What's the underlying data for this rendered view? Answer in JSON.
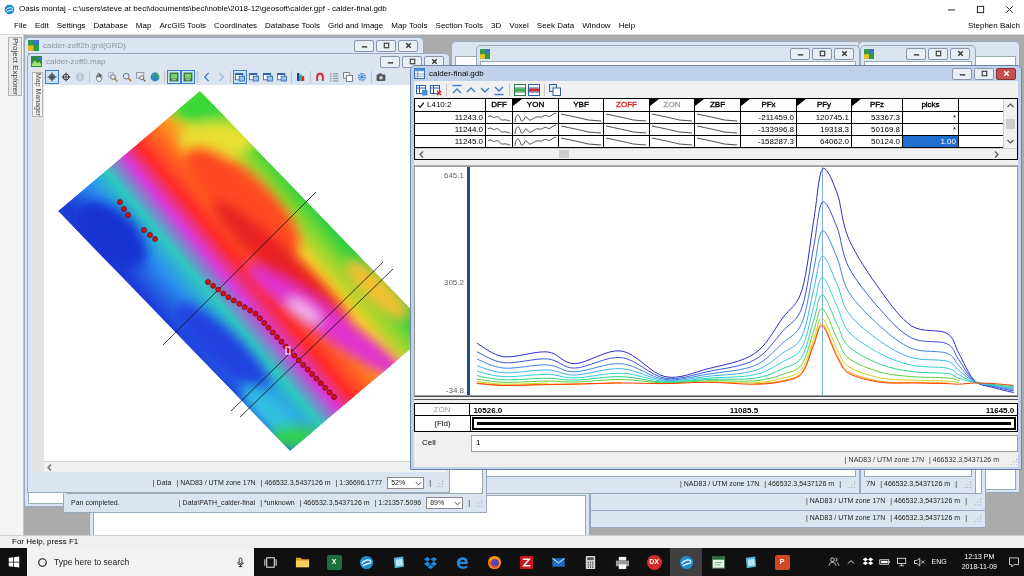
{
  "title_bar": {
    "title": "Oasis montaj - c:\\users\\steve at beci\\documents\\beci\\noble\\2018-12\\geosoft\\calder.gpf - calder-final.gdb"
  },
  "menu": {
    "items": [
      "File",
      "Edit",
      "Settings",
      "Database",
      "Map",
      "ArcGIS Tools",
      "Coordinates",
      "Database Tools",
      "Grid and Image",
      "Map Tools",
      "Section Tools",
      "3D",
      "Voxel",
      "Seek Data",
      "Window",
      "Help"
    ],
    "user": "Stephen Balch"
  },
  "project_explorer": {
    "label": "Project Explorer"
  },
  "grid_window": {
    "title": "calder-zoff2b.grd(GRD)"
  },
  "map_window": {
    "title": "calder-zoff0.map",
    "side_tab": "Map Manager",
    "toolbar": [
      [
        {
          "kind": "crosshair",
          "selected": true,
          "disabled": false
        },
        {
          "kind": "target",
          "selected": false,
          "disabled": false
        },
        {
          "kind": "info",
          "selected": false,
          "disabled": true
        }
      ],
      [
        {
          "kind": "hand",
          "selected": false,
          "disabled": false
        },
        {
          "kind": "magnifier-box",
          "selected": false,
          "disabled": false
        },
        {
          "kind": "magnifier",
          "selected": false,
          "disabled": false
        },
        {
          "kind": "box-magnifier",
          "selected": false,
          "disabled": false
        },
        {
          "kind": "globe",
          "selected": false,
          "disabled": false
        }
      ],
      [
        {
          "kind": "map-tile",
          "selected": true,
          "disabled": false
        },
        {
          "kind": "map-tile",
          "selected": true,
          "disabled": false
        }
      ],
      [
        {
          "kind": "chevron-left",
          "selected": false,
          "disabled": false
        },
        {
          "kind": "chevron-right",
          "selected": false,
          "disabled": true
        }
      ],
      [
        {
          "kind": "window",
          "selected": true,
          "disabled": false
        },
        {
          "kind": "window",
          "selected": false,
          "disabled": false
        },
        {
          "kind": "window",
          "selected": false,
          "disabled": false
        },
        {
          "kind": "window",
          "selected": false,
          "disabled": false
        }
      ],
      [
        {
          "kind": "color-bars",
          "selected": false,
          "disabled": false
        }
      ],
      [
        {
          "kind": "magnet",
          "selected": false,
          "disabled": false
        },
        {
          "kind": "list",
          "selected": false,
          "disabled": false
        },
        {
          "kind": "copy",
          "selected": false,
          "disabled": false
        },
        {
          "kind": "gear",
          "selected": false,
          "disabled": false
        }
      ],
      [
        {
          "kind": "camera",
          "selected": false,
          "disabled": false
        }
      ]
    ],
    "status": {
      "fields": [
        "| Data",
        "| NAD83 / UTM zone 17N",
        "| 466532.3,5437126 m",
        "| 1:36696.1777"
      ],
      "zoom": "52%",
      "end": "|"
    }
  },
  "path_window": {
    "message": "Pan completed.",
    "status": {
      "fields": [
        "| Data\\PATH_calder-final",
        "| *unknown",
        "| 466532.3,5437126 m",
        "| 1:21357.5096"
      ],
      "zoom": "89%",
      "end": "|"
    }
  },
  "background_windows": [
    {
      "status": [
        "| NAD83 / UTM zone 17N",
        "| 466532.3,5437126 m",
        "|"
      ]
    },
    {
      "status": [
        "7N",
        "| 466532.3,5437126 m",
        "|"
      ]
    },
    {
      "status": [
        "| NAD83 / UTM zone 17N",
        "| 466532.3,5437126 m",
        "|"
      ]
    },
    {
      "status": [
        "| NAD83 / UTM zone 17N",
        "| 466532.3,5437126 m",
        "|"
      ]
    }
  ],
  "database_window": {
    "title": "calder-final.gdb",
    "line": {
      "label": "L410:2",
      "checked": true
    },
    "columns": [
      {
        "label": "DFF",
        "kind": "wiggle",
        "marked": false,
        "color": "#000000"
      },
      {
        "label": "YON",
        "kind": "wave",
        "marked": true,
        "color": "#000000"
      },
      {
        "label": "YBF",
        "kind": "decay",
        "marked": false,
        "color": "#000000"
      },
      {
        "label": "ZOFF",
        "kind": "decay",
        "marked": false,
        "color": "#e02020"
      },
      {
        "label": "ZON",
        "kind": "decay",
        "marked": true,
        "color": "#a0a0a0"
      },
      {
        "label": "ZBF",
        "kind": "decay",
        "marked": true,
        "color": "#000000"
      },
      {
        "label": "PFx",
        "kind": "number",
        "marked": true,
        "color": "#000000"
      },
      {
        "label": "PFy",
        "kind": "number",
        "marked": true,
        "color": "#000000"
      },
      {
        "label": "PFz",
        "kind": "number",
        "marked": true,
        "color": "#000000"
      },
      {
        "label": "picks",
        "kind": "number",
        "marked": false,
        "color": "#000000"
      }
    ],
    "rows": [
      {
        "fid": "11243.0",
        "cells": [
          {
            "text": "-211459.0",
            "selected": false
          },
          {
            "text": "120745.1",
            "selected": false
          },
          {
            "text": "53367.3",
            "selected": false
          },
          {
            "text": "*",
            "selected": false
          }
        ]
      },
      {
        "fid": "11244.0",
        "cells": [
          {
            "text": "-133996.8",
            "selected": false
          },
          {
            "text": "19318.3",
            "selected": false
          },
          {
            "text": "50169.8",
            "selected": false
          },
          {
            "text": "*",
            "selected": false
          }
        ]
      },
      {
        "fid": "11245.0",
        "cells": [
          {
            "text": "-158287.3",
            "selected": false
          },
          {
            "text": "64062.0",
            "selected": false
          },
          {
            "text": "50124.0",
            "selected": false
          },
          {
            "text": "1.00",
            "selected": true
          }
        ]
      }
    ],
    "profile": {
      "chart_data": {
        "type": "line",
        "xlabel": "ZON",
        "x": [
          10503,
          10561,
          10656,
          10716,
          10818,
          10913,
          11007,
          11109,
          11170,
          11212,
          11238,
          11257,
          11289,
          11315,
          11384,
          11452,
          11529,
          11555,
          11589,
          11632,
          11674
        ],
        "series": [
          {
            "color": "#2e2ec8",
            "values": [
              115,
              73,
              88,
              51,
              91,
              10,
              35,
              83,
              195,
              282,
              503,
              665,
              590,
              443,
              282,
              170,
              147,
              84,
              -2,
              -25,
              -40
            ]
          },
          {
            "color": "#3a55d6",
            "values": [
              88,
              54,
              66,
              37,
              70,
              5,
              26,
              63,
              153,
              227,
              420,
              561,
              481,
              354,
              221,
              132,
              114,
              63,
              -4,
              -22,
              -35
            ]
          },
          {
            "color": "#3f86e0",
            "values": [
              65,
              37,
              47,
              25,
              51,
              1,
              18,
              45,
              116,
              179,
              348,
              470,
              385,
              276,
              168,
              99,
              84,
              45,
              -5,
              -20,
              -31
            ]
          },
          {
            "color": "#3cb4ea",
            "values": [
              44,
              22,
              31,
              15,
              35,
              -2,
              11,
              29,
              84,
              136,
              285,
              390,
              302,
              208,
              121,
              70,
              59,
              30,
              -6,
              -18,
              -28
            ]
          },
          {
            "color": "#2ed2d8",
            "values": [
              27,
              10,
              17,
              6,
              21,
              -5,
              5,
              16,
              57,
              101,
              231,
              323,
              232,
              151,
              82,
              46,
              37,
              16,
              -8,
              -16,
              -25
            ]
          },
          {
            "color": "#2cd68c",
            "values": [
              13,
              0,
              5,
              -1,
              10,
              -8,
              1,
              5,
              35,
              72,
              188,
              268,
              175,
              104,
              49,
              26,
              20,
              5,
              -8,
              -15,
              -22
            ]
          },
          {
            "color": "#5ccf3a",
            "values": [
              2,
              -8,
              -4,
              -7,
              1,
              -10,
              -3,
              -3,
              17,
              49,
              154,
              225,
              130,
              67,
              24,
              10,
              6,
              -3,
              null,
              null,
              null
            ]
          },
          {
            "color": "#c9d61e",
            "values": [
              -6,
              -14,
              -10,
              null,
              null,
              null,
              -6,
              -9,
              5,
              33,
              129,
              194,
              97,
              41,
              6,
              -1,
              -4,
              -9,
              null,
              null,
              null
            ]
          },
          {
            "color": "#ff9d00",
            "values": [
              -10,
              -17,
              -14,
              -13,
              -9,
              null,
              null,
              -13,
              -3,
              23,
              115,
              176,
              78,
              25,
              -5,
              -8,
              -10,
              null,
              null,
              null,
              null
            ]
          },
          {
            "color": "#ff3b00",
            "values": [
              -12,
              -18,
              -15,
              -14,
              -10,
              -12,
              -8,
              -14,
              -5,
              20,
              110,
              170,
              72,
              20,
              -8,
              -10,
              -12,
              -14,
              -10,
              -12,
              -18
            ]
          }
        ],
        "xlim": [
          10487,
          11680
        ],
        "ylim": [
          -48,
          672
        ],
        "xticks": [
          {
            "value": 10526,
            "label": "10526.0"
          },
          {
            "value": 11085.5,
            "label": "11085.5"
          },
          {
            "value": 11645,
            "label": "11645.0"
          }
        ],
        "yticks": [
          {
            "value": 645.1,
            "label": "645.1"
          },
          {
            "value": 305.2,
            "label": "305.2"
          },
          {
            "value": -34.8,
            "label": "-34.8"
          }
        ],
        "ref_lines": [
          {
            "axis": "x",
            "value": 11257,
            "color": "#6fa8dc"
          }
        ]
      }
    },
    "fid_label": "(Fid)",
    "cell_field": {
      "label": "Cell",
      "value": "1"
    },
    "status": [
      "| NAD83 / UTM zone 17N",
      "| 466532.3,5437126 m"
    ]
  },
  "status_bar": {
    "text": "For Help, press F1"
  },
  "taskbar": {
    "search": {
      "placeholder": "Type here to search"
    },
    "apps": [
      {
        "kind": "task-view",
        "selected": false
      },
      {
        "kind": "folder",
        "selected": false
      },
      {
        "kind": "letter-tile",
        "glyph": "X",
        "color": "#1d6f42",
        "selected": false
      },
      {
        "kind": "swirl",
        "selected": false
      },
      {
        "kind": "tilted-tile",
        "selected": false
      },
      {
        "kind": "diamonds",
        "selected": false
      },
      {
        "kind": "e-logo",
        "selected": false
      },
      {
        "kind": "ringed-disc",
        "selected": false
      },
      {
        "kind": "zigzag-tile",
        "selected": false
      },
      {
        "kind": "envelope",
        "selected": false
      },
      {
        "kind": "calculator",
        "selected": false
      },
      {
        "kind": "printer",
        "selected": false
      },
      {
        "kind": "letter-disc",
        "glyph": "DX",
        "color": "#d42b2b",
        "selected": false
      },
      {
        "kind": "swirl",
        "selected": true
      },
      {
        "kind": "window",
        "selected": false
      },
      {
        "kind": "tilted-tile",
        "selected": false
      },
      {
        "kind": "letter-tile",
        "glyph": "P",
        "color": "#d24726",
        "selected": false
      }
    ],
    "tray": {
      "language": "ENG",
      "time": "12:13 PM",
      "date": "2018-11-09"
    }
  }
}
